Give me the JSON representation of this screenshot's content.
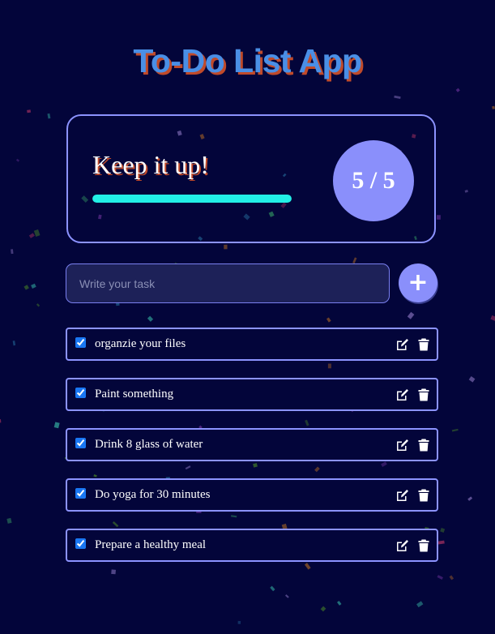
{
  "app": {
    "title": "To-Do List App"
  },
  "stats": {
    "heading": "Keep it up!",
    "completed": 5,
    "total": 5,
    "count_label": "5 / 5",
    "progress_percent": 100
  },
  "input": {
    "placeholder": "Write your task",
    "value": ""
  },
  "add_button": {
    "label": "+"
  },
  "tasks": [
    {
      "label": "organzie your files",
      "checked": true
    },
    {
      "label": "Paint something",
      "checked": true
    },
    {
      "label": "Drink 8 glass of water",
      "checked": true
    },
    {
      "label": "Do yoga for 30 minutes",
      "checked": true
    },
    {
      "label": "Prepare a healthy meal",
      "checked": true
    }
  ],
  "icons": {
    "edit": "edit-icon",
    "delete": "trash-icon"
  },
  "colors": {
    "background": "#03053a",
    "accent": "#8a8ffb",
    "progress": "#22f0e6",
    "title": "#4a8fe6",
    "title_shadow": "#c04a2a"
  }
}
